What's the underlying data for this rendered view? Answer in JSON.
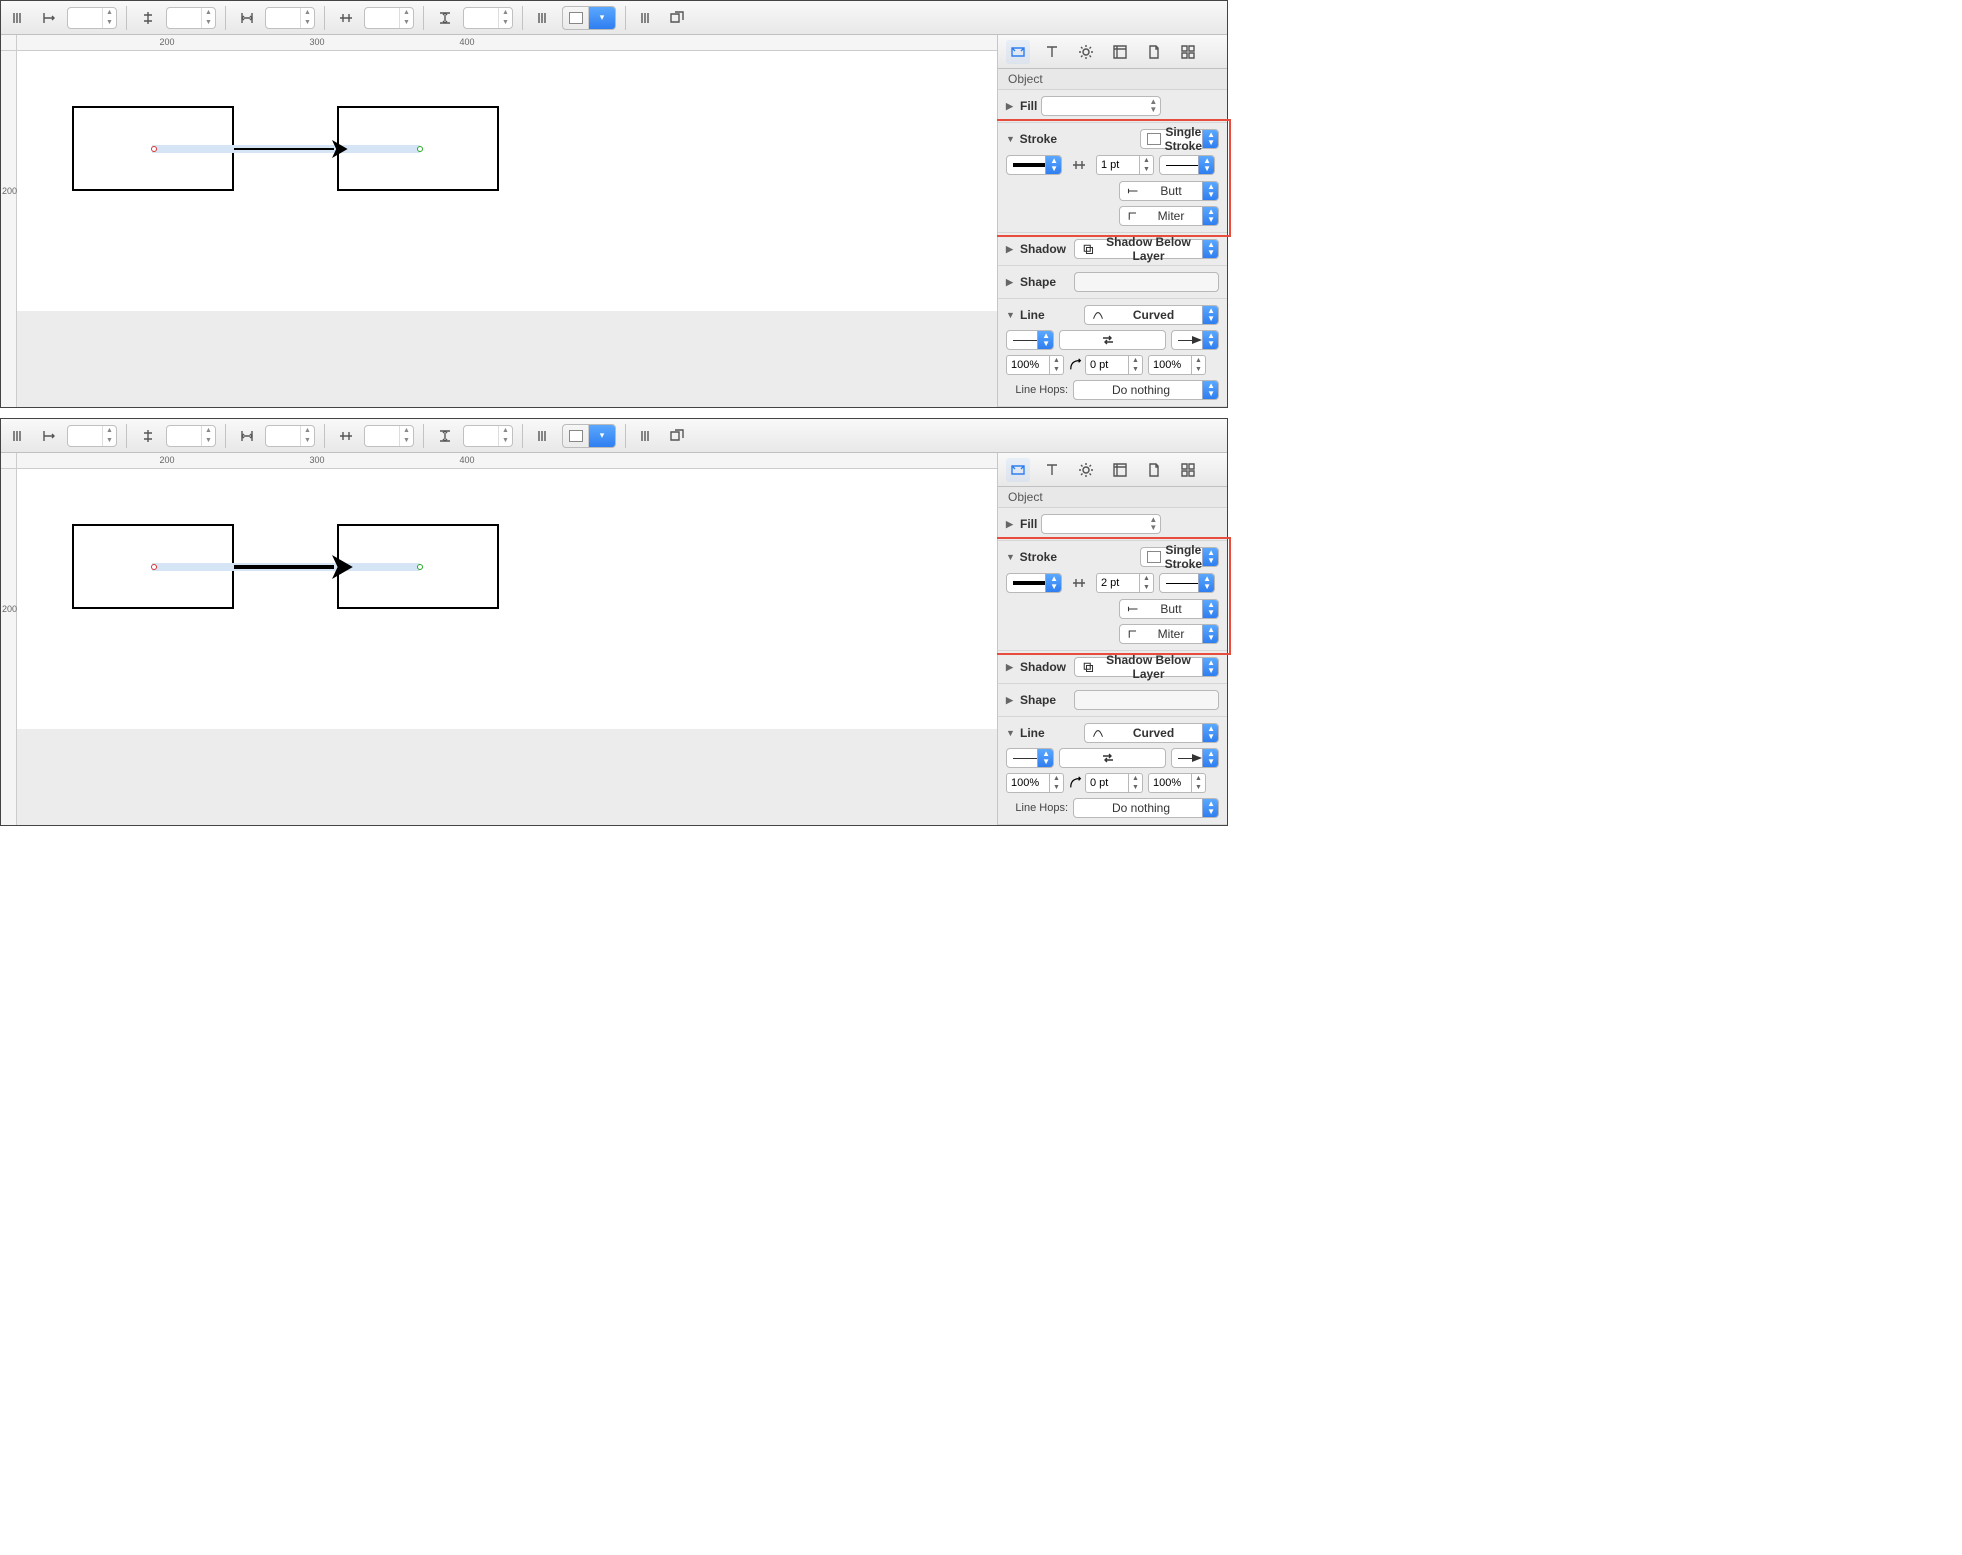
{
  "inspector_title": "Object",
  "ruler_marks_h": [
    "200",
    "300",
    "400"
  ],
  "ruler_marks_v": [
    "200"
  ],
  "sections": {
    "fill": {
      "label": "Fill",
      "expanded": false
    },
    "stroke": {
      "label": "Stroke",
      "expanded": true,
      "type": "Single Stroke",
      "cap": "Butt",
      "join": "Miter"
    },
    "shadow": {
      "label": "Shadow",
      "expanded": false,
      "value": "Shadow Below Layer"
    },
    "shape": {
      "label": "Shape",
      "expanded": false
    },
    "line": {
      "label": "Line",
      "expanded": true,
      "style": "Curved",
      "tail_pct": "100%",
      "radius": "0 pt",
      "head_pct": "100%",
      "hops_label": "Line Hops:",
      "hops_value": "Do nothing"
    }
  },
  "shots": [
    {
      "stroke_weight": "1 pt",
      "arrow_thickness": 2,
      "arrow_head": 12
    },
    {
      "stroke_weight": "2 pt",
      "arrow_thickness": 4,
      "arrow_head": 16
    }
  ]
}
